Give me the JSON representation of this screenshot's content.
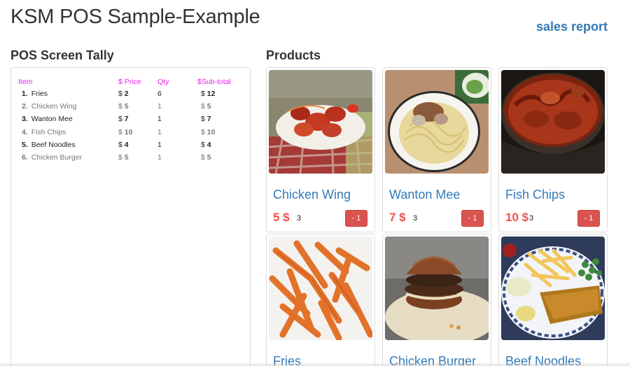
{
  "app": {
    "title": "KSM POS Sample-Example",
    "sales_report_label": "sales report"
  },
  "tally": {
    "heading": "POS Screen Tally",
    "columns": {
      "item": "Item",
      "price": "$ Price",
      "qty": "Qty",
      "subtotal": "$Sub-total"
    },
    "rows": [
      {
        "index": "1.",
        "name": "Fries",
        "price": "2",
        "qty": "6",
        "subtotal": "12"
      },
      {
        "index": "2.",
        "name": "Chicken Wing",
        "price": "5",
        "qty": "1",
        "subtotal": "5"
      },
      {
        "index": "3.",
        "name": "Wanton Mee",
        "price": "7",
        "qty": "1",
        "subtotal": "7"
      },
      {
        "index": "4.",
        "name": "Fish Chips",
        "price": "10",
        "qty": "1",
        "subtotal": "10"
      },
      {
        "index": "5.",
        "name": "Beef Noodles",
        "price": "4",
        "qty": "1",
        "subtotal": "4"
      },
      {
        "index": "6.",
        "name": "Chicken Burger",
        "price": "5",
        "qty": "1",
        "subtotal": "5"
      }
    ],
    "currency_symbol": "$"
  },
  "products": {
    "heading": "Products",
    "minus_label": "- 1",
    "items": [
      {
        "name": "Chicken Wing",
        "price": "5 $",
        "qty": "3"
      },
      {
        "name": "Wanton Mee",
        "price": "7 $",
        "qty": "3"
      },
      {
        "name": "Fish Chips",
        "price": "10 $",
        "qty": "3"
      },
      {
        "name": "Fries",
        "price": "",
        "qty": ""
      },
      {
        "name": "Chicken Burger",
        "price": "",
        "qty": ""
      },
      {
        "name": "Beef Noodles",
        "price": "",
        "qty": ""
      }
    ]
  },
  "colors": {
    "accent": "#337ab7",
    "price": "#f0524f",
    "button": "#d9534f",
    "tally_header": "#e91ee9"
  }
}
